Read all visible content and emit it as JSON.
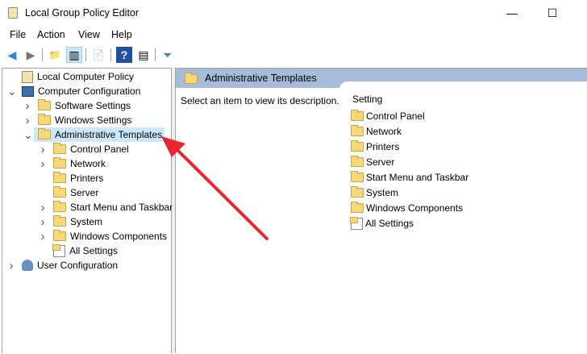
{
  "window": {
    "title": "Local Group Policy Editor",
    "minimize": "—",
    "maximize": "☐"
  },
  "menu": [
    "File",
    "Action",
    "View",
    "Help"
  ],
  "toolbar": {
    "back": "◀",
    "forward": "▶",
    "up": "📁",
    "show_hide": "▥",
    "export": "📄",
    "help": "?",
    "properties": "▤",
    "filter": "⏷"
  },
  "tree": [
    {
      "label": "Local Computer Policy",
      "level": 0,
      "expander": "",
      "icon": "doc"
    },
    {
      "label": "Computer Configuration",
      "level": 0,
      "expander": "v",
      "icon": "pc"
    },
    {
      "label": "Software Settings",
      "level": 1,
      "expander": ">",
      "icon": "folder"
    },
    {
      "label": "Windows Settings",
      "level": 1,
      "expander": ">",
      "icon": "folder"
    },
    {
      "label": "Administrative Templates",
      "level": 1,
      "expander": "v",
      "icon": "folder",
      "selected": true
    },
    {
      "label": "Control Panel",
      "level": 2,
      "expander": ">",
      "icon": "folder"
    },
    {
      "label": "Network",
      "level": 2,
      "expander": ">",
      "icon": "folder"
    },
    {
      "label": "Printers",
      "level": 2,
      "expander": "",
      "icon": "folder"
    },
    {
      "label": "Server",
      "level": 2,
      "expander": "",
      "icon": "folder"
    },
    {
      "label": "Start Menu and Taskbar",
      "level": 2,
      "expander": ">",
      "icon": "folder"
    },
    {
      "label": "System",
      "level": 2,
      "expander": ">",
      "icon": "folder"
    },
    {
      "label": "Windows Components",
      "level": 2,
      "expander": ">",
      "icon": "folder"
    },
    {
      "label": "All Settings",
      "level": 2,
      "expander": "",
      "icon": "all"
    },
    {
      "label": "User Configuration",
      "level": 0,
      "expander": ">",
      "icon": "user"
    }
  ],
  "right": {
    "header": "Administrative Templates",
    "description": "Select an item to view its description.",
    "column": "Setting",
    "items": [
      {
        "label": "Control Panel",
        "icon": "folder"
      },
      {
        "label": "Network",
        "icon": "folder"
      },
      {
        "label": "Printers",
        "icon": "folder"
      },
      {
        "label": "Server",
        "icon": "folder"
      },
      {
        "label": "Start Menu and Taskbar",
        "icon": "folder"
      },
      {
        "label": "System",
        "icon": "folder"
      },
      {
        "label": "Windows Components",
        "icon": "folder"
      },
      {
        "label": "All Settings",
        "icon": "all"
      }
    ]
  },
  "annotation_color": "#e8262e"
}
